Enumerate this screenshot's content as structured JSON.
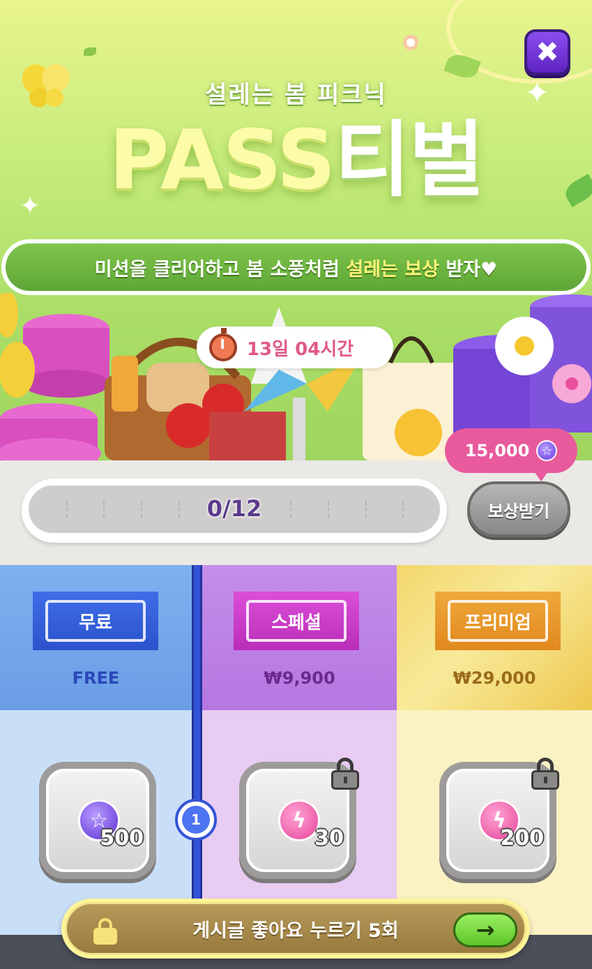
{
  "header": {
    "subtitle": "설레는 봄 피크닉",
    "title_part1": "PASS",
    "title_part2": "티벌",
    "banner_prefix": "미션을 클리어하고 봄 소풍처럼 ",
    "banner_highlight": "설레는 보상",
    "banner_suffix": " 받자♥",
    "close_label": "✖",
    "close_icon": "close-icon"
  },
  "timer": {
    "icon": "stopwatch-icon",
    "remaining": "13일 04시간"
  },
  "progress": {
    "label": "0/12",
    "current": 0,
    "total": 12,
    "fraction": 0
  },
  "claim": {
    "label": "보상받기",
    "bubble_amount": "15,000",
    "bubble_icon": "star-gem-icon"
  },
  "tiers": [
    {
      "name": "무료",
      "price": "FREE",
      "color": "#3f6ee8"
    },
    {
      "name": "스페셜",
      "price": "₩9,900",
      "color": "#db4fd8"
    },
    {
      "name": "프리미엄",
      "price": "₩29,000",
      "color": "#f0a83a"
    }
  ],
  "level": {
    "number": "1"
  },
  "rewards": [
    {
      "tier": "free",
      "icon": "star-gem-icon",
      "glyph": "☆",
      "amount": "500",
      "locked": false
    },
    {
      "tier": "special",
      "icon": "lightning-gem-icon",
      "glyph": "ϟ",
      "amount": "30",
      "locked": true
    },
    {
      "tier": "premium",
      "icon": "lightning-gem-icon",
      "glyph": "ϟ",
      "amount": "200",
      "locked": true
    }
  ],
  "mission": {
    "text": "게시글 좋아요 누르기 5회",
    "go_label": "→",
    "lock_icon": "lock-icon",
    "arrow_icon": "arrow-right-icon"
  }
}
